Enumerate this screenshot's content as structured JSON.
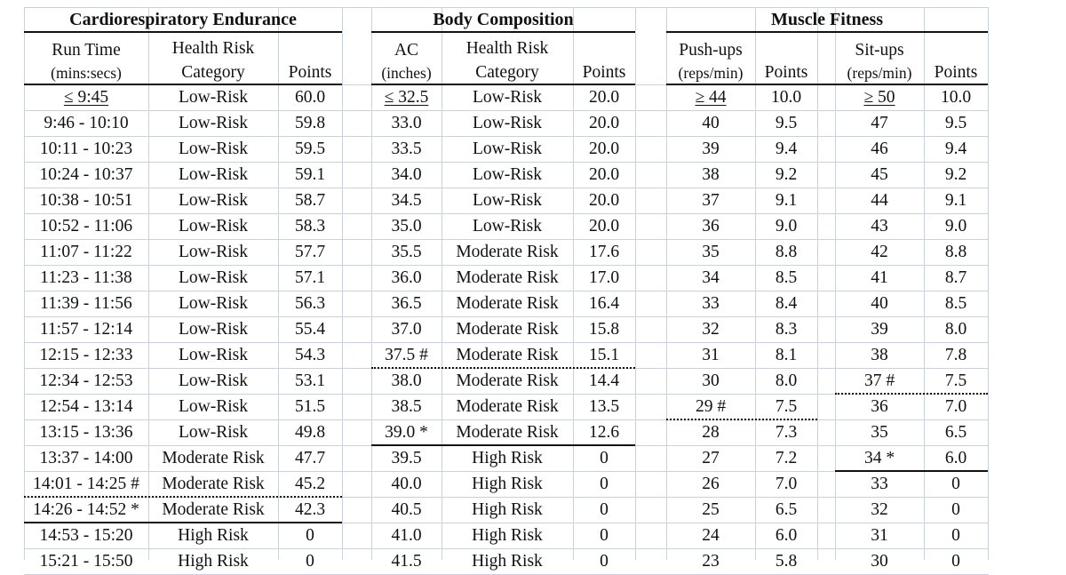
{
  "sections": {
    "cardio": {
      "title": "Cardiorespiratory Endurance",
      "headers": {
        "col1_l1": "Run Time",
        "col1_l2": "(mins:secs)",
        "col2_l1": "Health Risk",
        "col2_l2": "Category",
        "col3": "Points"
      },
      "rows": [
        {
          "time": "≤ 9:45",
          "risk": "Low-Risk",
          "points": "60.0"
        },
        {
          "time": "9:46 - 10:10",
          "risk": "Low-Risk",
          "points": "59.8"
        },
        {
          "time": "10:11 - 10:23",
          "risk": "Low-Risk",
          "points": "59.5"
        },
        {
          "time": "10:24 - 10:37",
          "risk": "Low-Risk",
          "points": "59.1"
        },
        {
          "time": "10:38 - 10:51",
          "risk": "Low-Risk",
          "points": "58.7"
        },
        {
          "time": "10:52 - 11:06",
          "risk": "Low-Risk",
          "points": "58.3"
        },
        {
          "time": "11:07 - 11:22",
          "risk": "Low-Risk",
          "points": "57.7"
        },
        {
          "time": "11:23 - 11:38",
          "risk": "Low-Risk",
          "points": "57.1"
        },
        {
          "time": "11:39 - 11:56",
          "risk": "Low-Risk",
          "points": "56.3"
        },
        {
          "time": "11:57 - 12:14",
          "risk": "Low-Risk",
          "points": "55.4"
        },
        {
          "time": "12:15 - 12:33",
          "risk": "Low-Risk",
          "points": "54.3"
        },
        {
          "time": "12:34 - 12:53",
          "risk": "Low-Risk",
          "points": "53.1"
        },
        {
          "time": "12:54 - 13:14",
          "risk": "Low-Risk",
          "points": "51.5"
        },
        {
          "time": "13:15 - 13:36",
          "risk": "Low-Risk",
          "points": "49.8"
        },
        {
          "time": "13:37 - 14:00",
          "risk": "Moderate Risk",
          "points": "47.7"
        },
        {
          "time": "14:01 - 14:25 #",
          "risk": "Moderate Risk",
          "points": "45.2"
        },
        {
          "time": "14:26 - 14:52 *",
          "risk": "Moderate Risk",
          "points": "42.3"
        },
        {
          "time": "14:53 - 15:20",
          "risk": "High Risk",
          "points": "0"
        },
        {
          "time": "15:21 - 15:50",
          "risk": "High Risk",
          "points": "0"
        }
      ]
    },
    "body": {
      "title": "Body Composition",
      "headers": {
        "col1_l1": "AC",
        "col1_l2": "(inches)",
        "col2_l1": "Health Risk",
        "col2_l2": "Category",
        "col3": "Points"
      },
      "rows": [
        {
          "ac": "≤ 32.5",
          "risk": "Low-Risk",
          "points": "20.0"
        },
        {
          "ac": "33.0",
          "risk": "Low-Risk",
          "points": "20.0"
        },
        {
          "ac": "33.5",
          "risk": "Low-Risk",
          "points": "20.0"
        },
        {
          "ac": "34.0",
          "risk": "Low-Risk",
          "points": "20.0"
        },
        {
          "ac": "34.5",
          "risk": "Low-Risk",
          "points": "20.0"
        },
        {
          "ac": "35.0",
          "risk": "Low-Risk",
          "points": "20.0"
        },
        {
          "ac": "35.5",
          "risk": "Moderate Risk",
          "points": "17.6"
        },
        {
          "ac": "36.0",
          "risk": "Moderate Risk",
          "points": "17.0"
        },
        {
          "ac": "36.5",
          "risk": "Moderate Risk",
          "points": "16.4"
        },
        {
          "ac": "37.0",
          "risk": "Moderate Risk",
          "points": "15.8"
        },
        {
          "ac": "37.5 #",
          "risk": "Moderate Risk",
          "points": "15.1"
        },
        {
          "ac": "38.0",
          "risk": "Moderate Risk",
          "points": "14.4"
        },
        {
          "ac": "38.5",
          "risk": "Moderate Risk",
          "points": "13.5"
        },
        {
          "ac": "39.0 *",
          "risk": "Moderate Risk",
          "points": "12.6"
        },
        {
          "ac": "39.5",
          "risk": "High Risk",
          "points": "0"
        },
        {
          "ac": "40.0",
          "risk": "High Risk",
          "points": "0"
        },
        {
          "ac": "40.5",
          "risk": "High Risk",
          "points": "0"
        },
        {
          "ac": "41.0",
          "risk": "High Risk",
          "points": "0"
        },
        {
          "ac": "41.5",
          "risk": "High Risk",
          "points": "0"
        }
      ]
    },
    "muscle": {
      "title": "Muscle Fitness",
      "headers": {
        "push_l1": "Push-ups",
        "push_l2": "(reps/min)",
        "push_points": "Points",
        "sit_l1": "Sit-ups",
        "sit_l2": "(reps/min)",
        "sit_points": "Points"
      },
      "rows": [
        {
          "push": "≥ 44",
          "push_points": "10.0",
          "sit": "≥ 50",
          "sit_points": "10.0"
        },
        {
          "push": "40",
          "push_points": "9.5",
          "sit": "47",
          "sit_points": "9.5"
        },
        {
          "push": "39",
          "push_points": "9.4",
          "sit": "46",
          "sit_points": "9.4"
        },
        {
          "push": "38",
          "push_points": "9.2",
          "sit": "45",
          "sit_points": "9.2"
        },
        {
          "push": "37",
          "push_points": "9.1",
          "sit": "44",
          "sit_points": "9.1"
        },
        {
          "push": "36",
          "push_points": "9.0",
          "sit": "43",
          "sit_points": "9.0"
        },
        {
          "push": "35",
          "push_points": "8.8",
          "sit": "42",
          "sit_points": "8.8"
        },
        {
          "push": "34",
          "push_points": "8.5",
          "sit": "41",
          "sit_points": "8.7"
        },
        {
          "push": "33",
          "push_points": "8.4",
          "sit": "40",
          "sit_points": "8.5"
        },
        {
          "push": "32",
          "push_points": "8.3",
          "sit": "39",
          "sit_points": "8.0"
        },
        {
          "push": "31",
          "push_points": "8.1",
          "sit": "38",
          "sit_points": "7.8"
        },
        {
          "push": "30",
          "push_points": "8.0",
          "sit": "37 #",
          "sit_points": "7.5"
        },
        {
          "push": "29 #",
          "push_points": "7.5",
          "sit": "36",
          "sit_points": "7.0"
        },
        {
          "push": "28",
          "push_points": "7.3",
          "sit": "35",
          "sit_points": "6.5"
        },
        {
          "push": "27",
          "push_points": "7.2",
          "sit": "34 *",
          "sit_points": "6.0"
        },
        {
          "push": "26",
          "push_points": "7.0",
          "sit": "33",
          "sit_points": "0"
        },
        {
          "push": "25",
          "push_points": "6.5",
          "sit": "32",
          "sit_points": "0"
        },
        {
          "push": "24",
          "push_points": "6.0",
          "sit": "31",
          "sit_points": "0"
        },
        {
          "push": "23",
          "push_points": "5.8",
          "sit": "30",
          "sit_points": "0"
        }
      ]
    }
  },
  "markers": {
    "cardio_dotted_after_row": 15,
    "cardio_solid_after_row": 16,
    "body_dotted_after_row": 10,
    "body_solid_after_row": 13,
    "push_dotted_after_row": 12,
    "sit_dotted_after_row": 11,
    "sit_solid_after_row": 14
  }
}
